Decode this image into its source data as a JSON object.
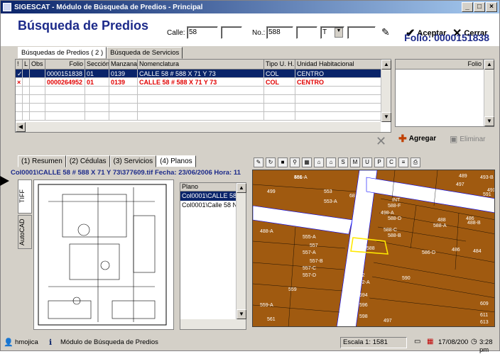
{
  "window": {
    "title": "SIGESCAT - Módulo de Búsqueda de Predios - Principal",
    "minimize": "_",
    "maximize": "□",
    "close": "×"
  },
  "header": {
    "page_title": "Búsqueda de Predios",
    "calle_label": "Calle:",
    "calle_value": "58",
    "no_label": "No.:",
    "no_value": "588",
    "select_value": "T",
    "aceptar": "Aceptar",
    "cerrar": "Cerrar",
    "folio": "Folio: 0000151838"
  },
  "search_tabs": [
    "Búsquedas de Predios ( 2 )",
    "Búsqueda de Servicios"
  ],
  "grid": {
    "columns": [
      "!",
      "L",
      "Obs",
      "Folio",
      "Sección",
      "Manzana",
      "Nomenclatura",
      "Tipo U. H.",
      "Unidad Habitacional"
    ],
    "rows": [
      {
        "status": "✓",
        "folio": "0000151838",
        "seccion": "01",
        "manzana": "0139",
        "nomenclatura": "CALLE 58 # 588 X 71 Y 73",
        "tipo": "COL",
        "unidad": "CENTRO"
      },
      {
        "status": "×",
        "folio": "0000264952",
        "seccion": "01",
        "manzana": "0139",
        "nomenclatura": "CALLE 58 # 588 X 71 Y 73",
        "tipo": "COL",
        "unidad": "CENTRO"
      }
    ]
  },
  "grid2": {
    "column": "Folio"
  },
  "actions": {
    "agregar": "Agregar",
    "eliminar": "Eliminar"
  },
  "lower_tabs": [
    "(1) Resumen",
    "(2) Cédulas",
    "(3) Servicios",
    "(4) Planos"
  ],
  "path_line": "Col0001\\CALLE 58 # 588 X 71 Y 73\\377609.tif Fecha: 23/06/2006 Hora: 11",
  "vtabs": [
    "TIFF",
    "AutoCAD"
  ],
  "plano_list": {
    "header": "Plano",
    "items": [
      "Col0001\\CALLE 58",
      "Col0001\\Calle 58 N"
    ]
  },
  "map": {
    "labels": [
      "551",
      "499",
      "553",
      "553-A",
      "584-A",
      "496",
      "497",
      "491",
      "493-B",
      "489",
      "588-F",
      "588-D",
      "488",
      "486",
      "498-A",
      "488-A",
      "555-A",
      "557",
      "557-A",
      "557-B",
      "557-C",
      "557-D",
      "588",
      "586-D",
      "486",
      "484",
      "559",
      "592",
      "592-A",
      "590",
      "594",
      "596",
      "598",
      "497",
      "559-A",
      "561",
      "609",
      "611",
      "613",
      "68",
      "71",
      "591",
      "INT",
      "588-C",
      "588-B",
      "588-A",
      "488-B",
      "486-A"
    ]
  },
  "status": {
    "user": "hmojica",
    "module": "Módulo de Búsqueda de Predios",
    "scale": "Escala 1: 1581",
    "date": "17/08/200",
    "time": "3:28 pm"
  },
  "colors": {
    "title_blue": "#1c2a8a",
    "selection": "#0a246a",
    "error_red": "#e00000",
    "map_bg": "#a05a10",
    "highlight": "#ffe800"
  }
}
